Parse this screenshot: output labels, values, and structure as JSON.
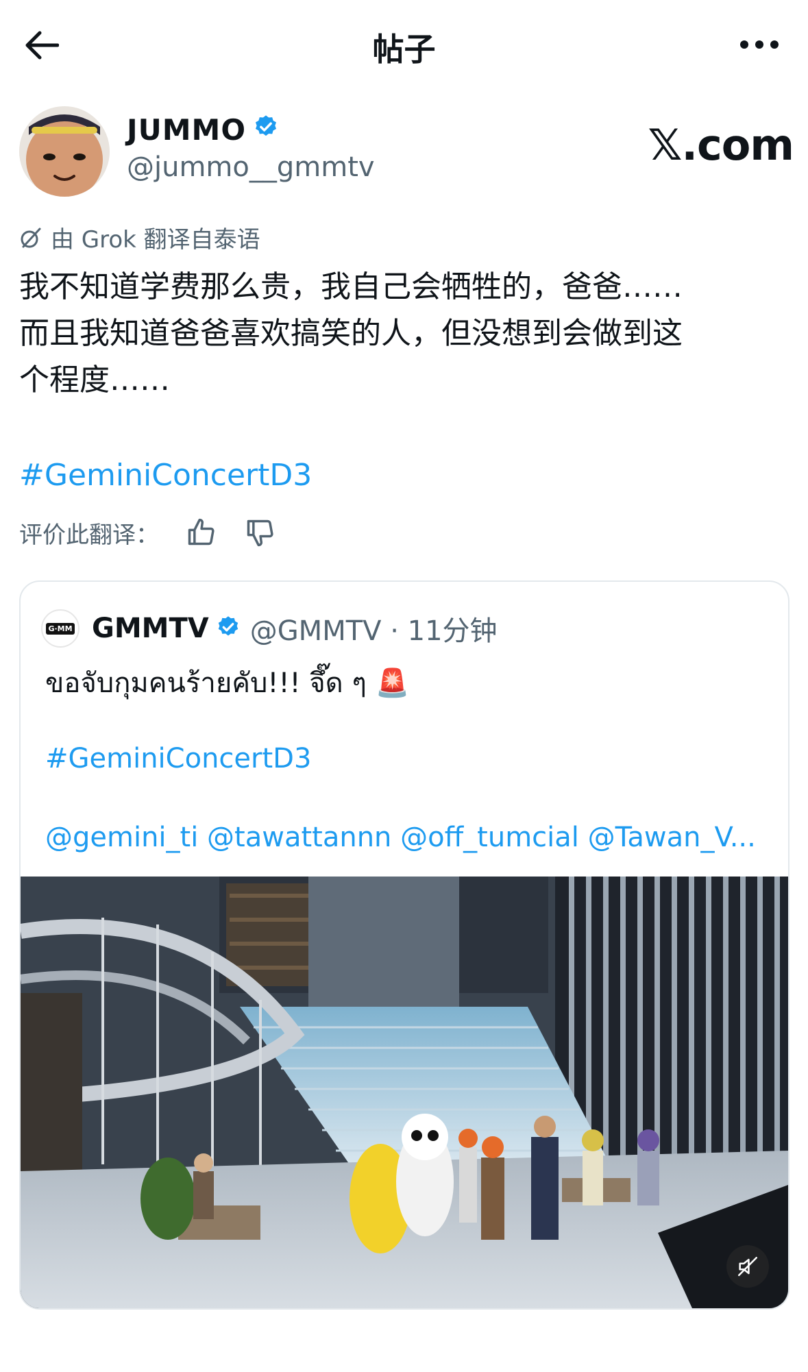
{
  "header": {
    "title": "帖子"
  },
  "author": {
    "name": "JUMMO",
    "handle": "@jummo__gmmtv",
    "brand": "𝕏.com"
  },
  "translation": {
    "note": "由 Grok 翻译自泰语"
  },
  "post": {
    "lines": [
      "我不知道学费那么贵，我自己会牺牲的，爸爸……",
      "而且我知道爸爸喜欢搞笑的人，但没想到会做到这",
      "个程度……"
    ],
    "hashtag": "#GeminiConcertD3"
  },
  "rate": {
    "label": "评价此翻译："
  },
  "quote": {
    "avatar_text": "G·MM",
    "name": "GMMTV",
    "handle": "@GMMTV · 11分钟",
    "text": "ขอจับกุมคนร้ายคับ!!! จึ๊ด ๆ 🚨",
    "hashtag": "#GeminiConcertD3",
    "mentions": "@gemini_ti @tawattannn @off_tumcial @Tawan_V..."
  },
  "colors": {
    "link": "#1d9bf0",
    "verified": "#1d9bf0",
    "secondary": "#536471"
  }
}
